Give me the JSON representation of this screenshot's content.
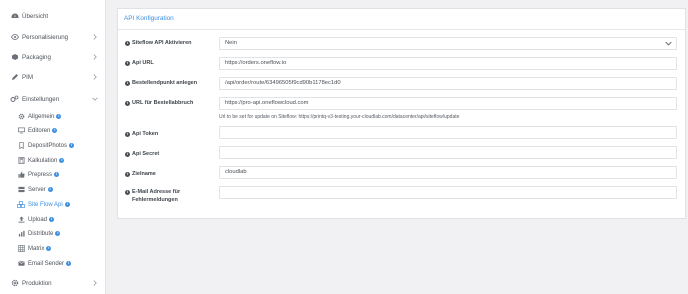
{
  "sidebar": {
    "items": [
      {
        "label": "Übersicht",
        "icon": "dashboard-icon"
      },
      {
        "label": "Personalisierung",
        "icon": "eye-icon"
      },
      {
        "label": "Packaging",
        "icon": "box-icon"
      },
      {
        "label": "PIM",
        "icon": "pencil-icon"
      },
      {
        "label": "Einstellungen",
        "icon": "gears-icon"
      },
      {
        "label": "Produktion",
        "icon": "gear-icon"
      }
    ],
    "subitems": [
      {
        "label": "Allgemein",
        "icon": "gear-icon"
      },
      {
        "label": "Editoren",
        "icon": "monitor-icon"
      },
      {
        "label": "DepositPhotos",
        "icon": "bookmark-icon"
      },
      {
        "label": "Kalkulation",
        "icon": "calculator-icon"
      },
      {
        "label": "Prepress",
        "icon": "thumbs-up-icon"
      },
      {
        "label": "Server",
        "icon": "server-icon"
      },
      {
        "label": "Site Flow Api",
        "icon": "cubes-icon"
      },
      {
        "label": "Upload",
        "icon": "upload-icon"
      },
      {
        "label": "Distribute",
        "icon": "chart-icon"
      },
      {
        "label": "Matrix",
        "icon": "grid-icon"
      },
      {
        "label": "Email Sender",
        "icon": "envelope-icon"
      }
    ]
  },
  "panel": {
    "title": "API Konfiguration",
    "fields": [
      {
        "label": "Siteflow API Aktivieren",
        "value": "Nein"
      },
      {
        "label": "Api URL",
        "value": "https://orders.oneflow.io"
      },
      {
        "label": "Bestellendpunkt anlegen",
        "value": "/api/order/route/63496505f9cd90b1178ec1d0"
      },
      {
        "label": "URL für Bestellabbruch",
        "value": "https://pro-api.oneflowcloud.com"
      },
      {
        "label": "Api Token",
        "value": ""
      },
      {
        "label": "Api Secret",
        "value": ""
      },
      {
        "label": "Zielname",
        "value": "cloudlab"
      },
      {
        "label": "E-Mail Adresse für Fehlermeldungen",
        "value": ""
      }
    ],
    "hint": "Url to be set for update on Siteflow: https://printq-v3-testing.your-cloudlab.com/datacenter/api/siteflow/update"
  },
  "colors": {
    "accent": "#3d8fe0",
    "info_dot": "#3d8fe0"
  }
}
